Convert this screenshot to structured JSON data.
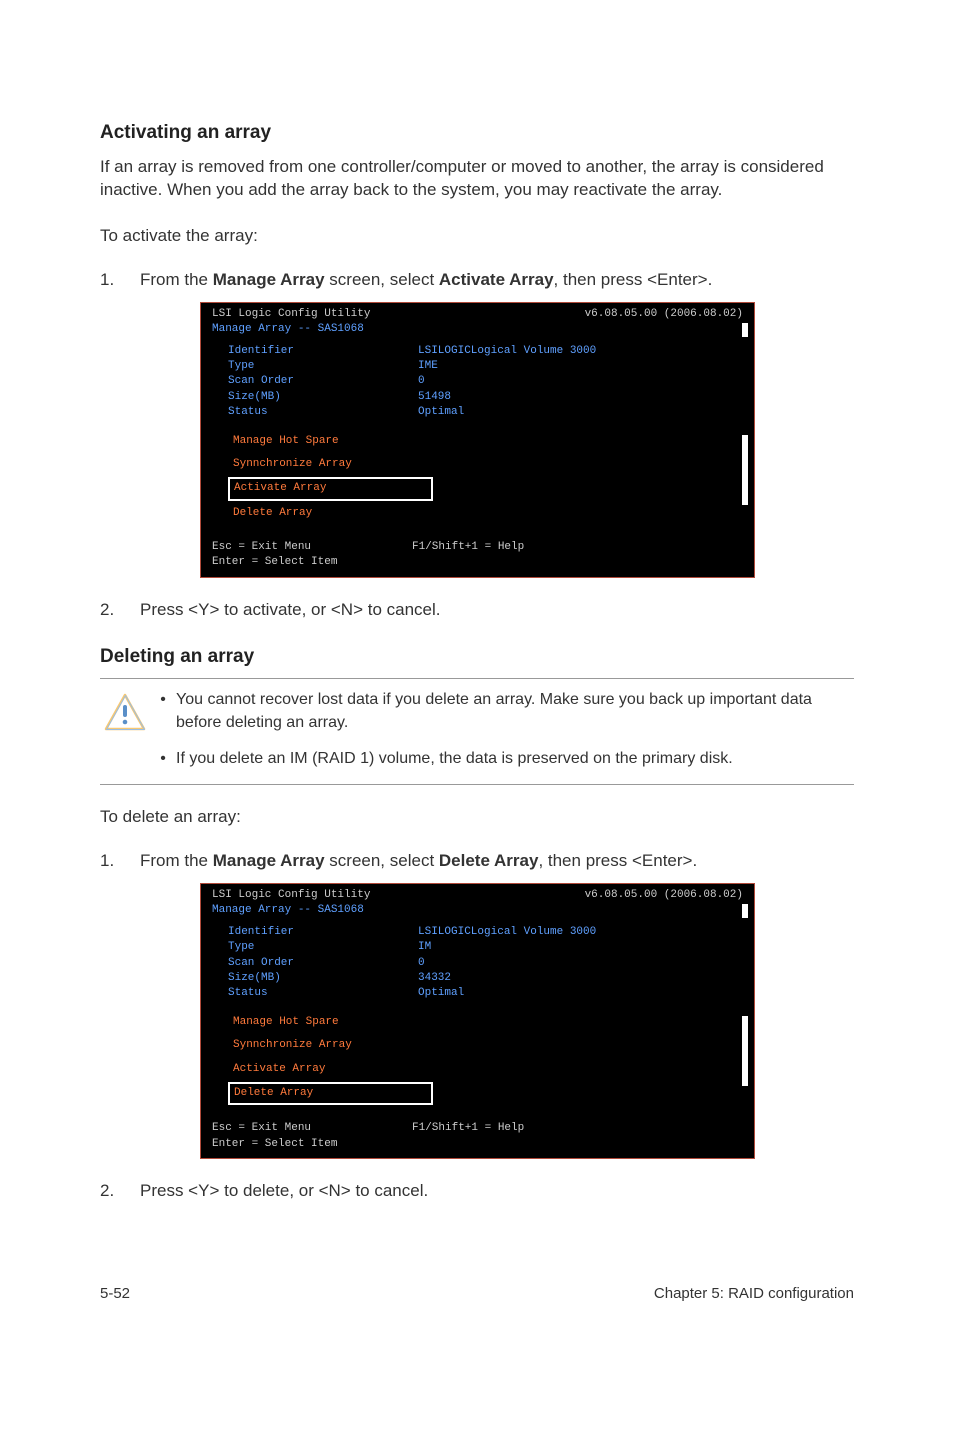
{
  "section1": {
    "heading": "Activating an array",
    "intro": "If an array is removed from one controller/computer or moved to another, the array is considered inactive. When you add the array back to the system, you may reactivate the array.",
    "lead": "To activate the array:",
    "step1": {
      "num": "1.",
      "pre": "From the ",
      "bold1": "Manage Array",
      "mid": " screen, select ",
      "bold2": "Activate Array",
      "post": ", then press <Enter>."
    },
    "step2": {
      "num": "2.",
      "text": "Press <Y> to activate, or <N> to cancel."
    }
  },
  "console1": {
    "header_left": "LSI Logic Config Utility",
    "header_right": "v6.08.05.00 (2006.08.02)",
    "subtitle": "Manage Array -- SAS1068",
    "rows": [
      {
        "lbl": "Identifier",
        "val": "LSILOGICLogical Volume  3000"
      },
      {
        "lbl": "Type",
        "val": "IME"
      },
      {
        "lbl": "Scan Order",
        "val": "0"
      },
      {
        "lbl": "Size(MB)",
        "val": "51498"
      },
      {
        "lbl": "Status",
        "val": "Optimal"
      }
    ],
    "menu": [
      {
        "label": "Manage Hot Spare",
        "sel": false
      },
      {
        "label": "Synnchronize Array",
        "sel": false
      },
      {
        "label": "Activate Array",
        "sel": true
      },
      {
        "label": "Delete Array",
        "sel": false
      }
    ],
    "foot1_l": "Esc = Exit Menu",
    "foot1_r": "F1/Shift+1 = Help",
    "foot2": "Enter = Select Item"
  },
  "section2": {
    "heading": "Deleting an array",
    "caution": [
      "You cannot recover lost data if you delete an array. Make sure you back up important data before deleting an array.",
      "If you delete an IM (RAID 1) volume, the data is preserved on the primary disk."
    ],
    "lead": "To delete an array:",
    "step1": {
      "num": "1.",
      "pre": "From the ",
      "bold1": "Manage Array",
      "mid": " screen, select ",
      "bold2": "Delete Array",
      "post": ", then press <Enter>."
    },
    "step2": {
      "num": "2.",
      "text": "Press <Y> to delete, or <N> to cancel."
    }
  },
  "console2": {
    "header_left": "LSI Logic Config Utility",
    "header_right": "v6.08.05.00 (2006.08.02)",
    "subtitle": "Manage Array -- SAS1068",
    "rows": [
      {
        "lbl": "Identifier",
        "val": "LSILOGICLogical Volume  3000"
      },
      {
        "lbl": "Type",
        "val": "IM"
      },
      {
        "lbl": "Scan Order",
        "val": "0"
      },
      {
        "lbl": "Size(MB)",
        "val": "34332"
      },
      {
        "lbl": "Status",
        "val": "Optimal"
      }
    ],
    "menu": [
      {
        "label": "Manage Hot Spare",
        "sel": false
      },
      {
        "label": "Synnchronize Array",
        "sel": false
      },
      {
        "label": "Activate Array",
        "sel": false
      },
      {
        "label": "Delete Array",
        "sel": true
      }
    ],
    "foot1_l": "Esc = Exit Menu",
    "foot1_r": "F1/Shift+1 = Help",
    "foot2": "Enter = Select Item"
  },
  "footer": {
    "left": "5-52",
    "right": "Chapter 5: RAID configuration"
  }
}
